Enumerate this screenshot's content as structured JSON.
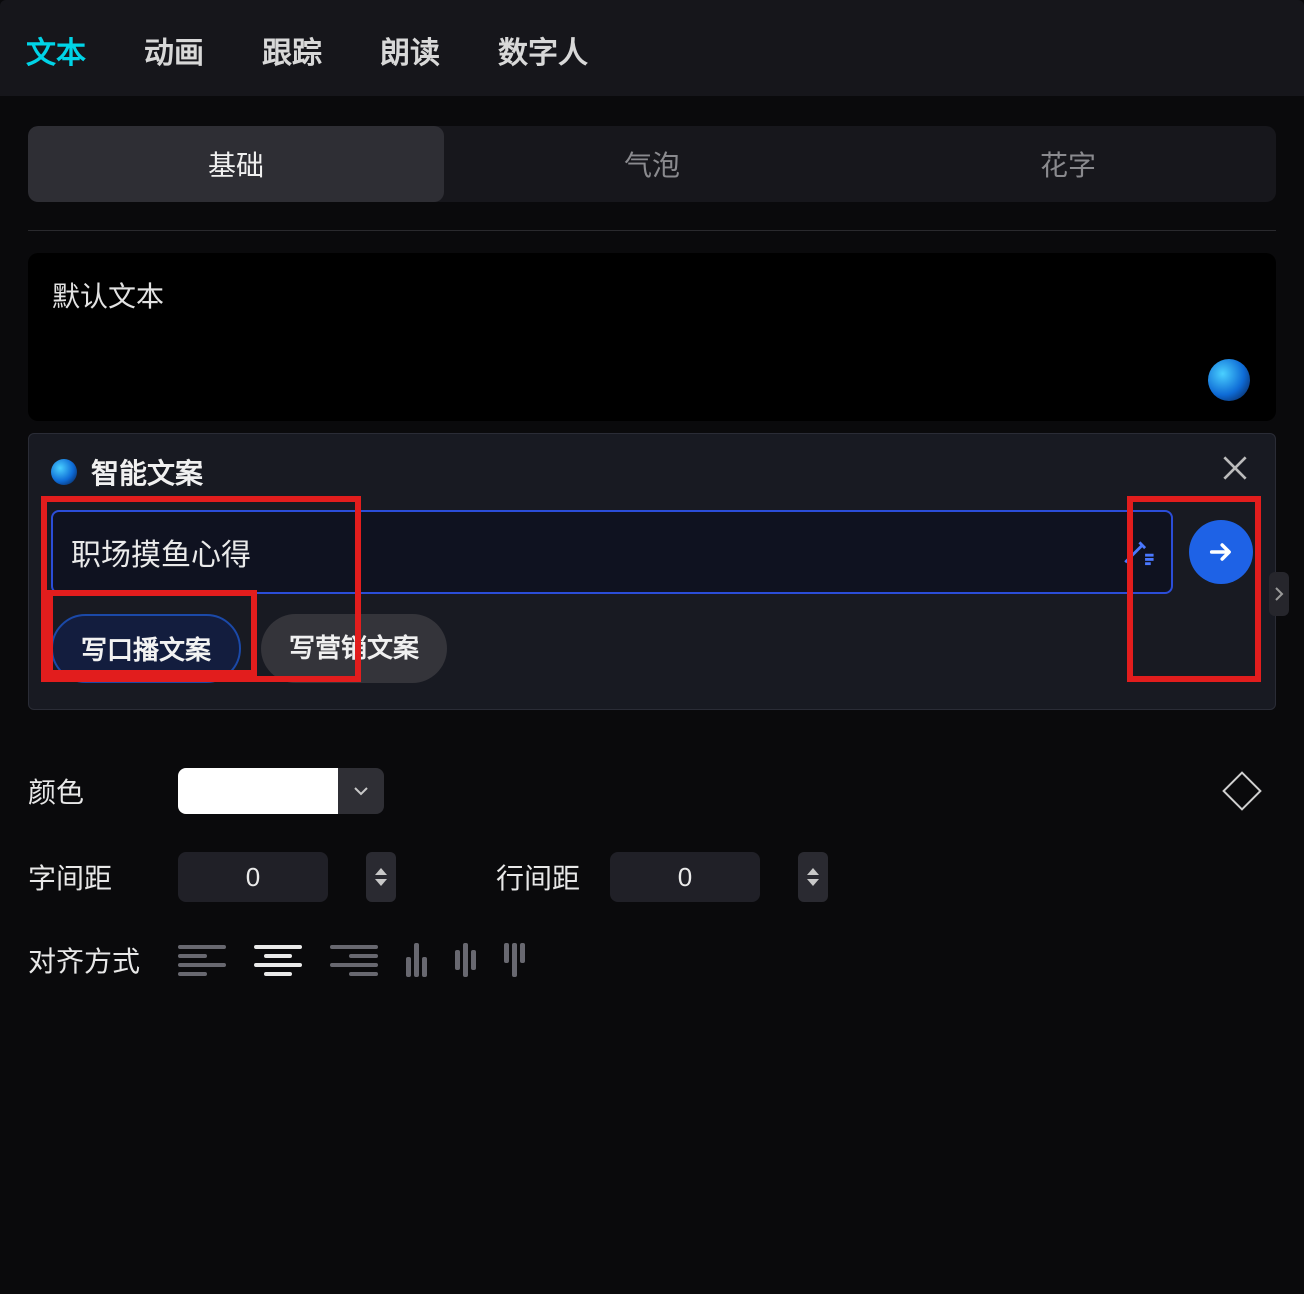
{
  "topTabs": {
    "text": "文本",
    "animation": "动画",
    "tracking": "跟踪",
    "read": "朗读",
    "digitalHuman": "数字人",
    "activeIndex": 0
  },
  "subTabs": {
    "basic": "基础",
    "bubble": "气泡",
    "fancy": "花字",
    "activeIndex": 0
  },
  "textBox": {
    "default": "默认文本"
  },
  "aiPanel": {
    "title": "智能文案",
    "inputValue": "职场摸鱼心得",
    "chips": {
      "broadcast": "写口播文案",
      "marketing": "写营销文案",
      "activeIndex": 0
    }
  },
  "props": {
    "color_label": "颜色",
    "color_value": "#FFFFFF",
    "letterSpacing_label": "字间距",
    "letterSpacing_value": "0",
    "lineSpacing_label": "行间距",
    "lineSpacing_value": "0",
    "align_label": "对齐方式"
  }
}
